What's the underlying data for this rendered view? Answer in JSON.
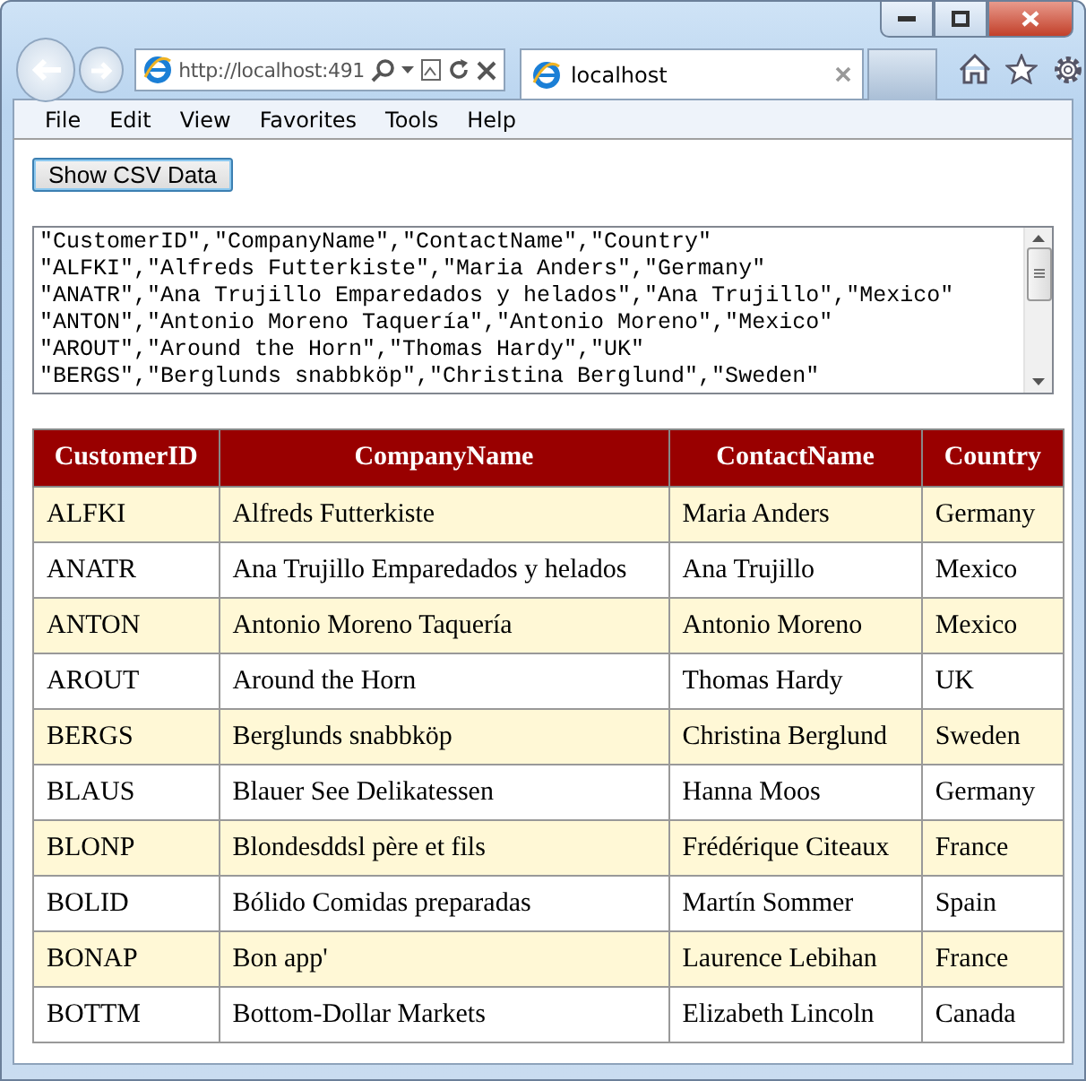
{
  "browser": {
    "address": "http://localhost:491",
    "tab_title": "localhost"
  },
  "menu": [
    "File",
    "Edit",
    "View",
    "Favorites",
    "Tools",
    "Help"
  ],
  "button": "Show CSV Data",
  "csv_lines": [
    "\"CustomerID\",\"CompanyName\",\"ContactName\",\"Country\"",
    "\"ALFKI\",\"Alfreds Futterkiste\",\"Maria Anders\",\"Germany\"",
    "\"ANATR\",\"Ana Trujillo Emparedados y helados\",\"Ana Trujillo\",\"Mexico\"",
    "\"ANTON\",\"Antonio Moreno Taquería\",\"Antonio Moreno\",\"Mexico\"",
    "\"AROUT\",\"Around the Horn\",\"Thomas Hardy\",\"UK\"",
    "\"BERGS\",\"Berglunds snabbköp\",\"Christina Berglund\",\"Sweden\""
  ],
  "table": {
    "columns": [
      "CustomerID",
      "CompanyName",
      "ContactName",
      "Country"
    ],
    "rows": [
      [
        "ALFKI",
        "Alfreds Futterkiste",
        "Maria Anders",
        "Germany"
      ],
      [
        "ANATR",
        "Ana Trujillo Emparedados y helados",
        "Ana Trujillo",
        "Mexico"
      ],
      [
        "ANTON",
        "Antonio Moreno Taquería",
        "Antonio Moreno",
        "Mexico"
      ],
      [
        "AROUT",
        "Around the Horn",
        "Thomas Hardy",
        "UK"
      ],
      [
        "BERGS",
        "Berglunds snabbköp",
        "Christina Berglund",
        "Sweden"
      ],
      [
        "BLAUS",
        "Blauer See Delikatessen",
        "Hanna Moos",
        "Germany"
      ],
      [
        "BLONP",
        "Blondesddsl père et fils",
        "Frédérique Citeaux",
        "France"
      ],
      [
        "BOLID",
        "Bólido Comidas preparadas",
        "Martín Sommer",
        "Spain"
      ],
      [
        "BONAP",
        "Bon app'",
        "Laurence Lebihan",
        "France"
      ],
      [
        "BOTTM",
        "Bottom-Dollar Markets",
        "Elizabeth Lincoln",
        "Canada"
      ]
    ]
  }
}
